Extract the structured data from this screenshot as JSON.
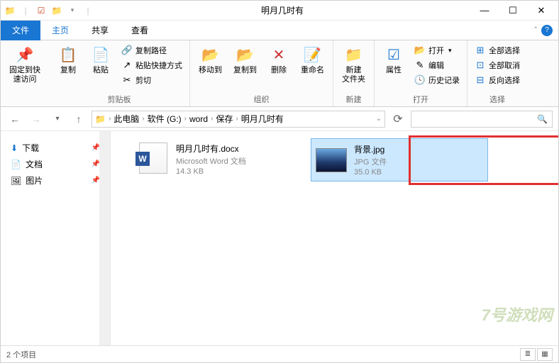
{
  "window": {
    "title": "明月几时有"
  },
  "menubar": {
    "file": "文件",
    "home": "主页",
    "share": "共享",
    "view": "查看"
  },
  "ribbon": {
    "pin": {
      "label": "固定到快\n速访问"
    },
    "copy": "复制",
    "paste": "粘贴",
    "copy_path": "复制路径",
    "paste_shortcut": "粘贴快捷方式",
    "cut": "剪切",
    "g_clipboard": "剪贴板",
    "move_to": "移动到",
    "copy_to": "复制到",
    "delete": "删除",
    "rename": "重命名",
    "g_organize": "组织",
    "new_folder": "新建\n文件夹",
    "g_new": "新建",
    "properties": "属性",
    "open": "打开",
    "edit": "编辑",
    "history": "历史记录",
    "g_open": "打开",
    "select_all": "全部选择",
    "select_none": "全部取消",
    "invert": "反向选择",
    "g_select": "选择"
  },
  "breadcrumbs": [
    "此电脑",
    "软件 (G:)",
    "word",
    "保存",
    "明月几时有"
  ],
  "sidebar": {
    "downloads": "下载",
    "documents": "文档",
    "pictures": "图片"
  },
  "files": [
    {
      "name": "明月几时有.docx",
      "type": "Microsoft Word 文档",
      "size": "14.3 KB"
    },
    {
      "name": "背景.jpg",
      "type": "JPG 文件",
      "size": "35.0 KB"
    }
  ],
  "status": {
    "count": "2 个项目"
  },
  "watermark": "7号游戏网"
}
